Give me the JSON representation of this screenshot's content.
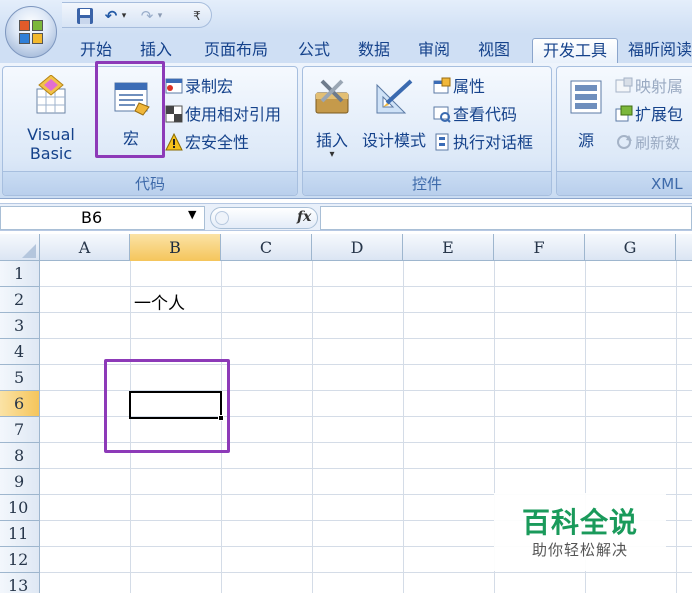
{
  "quick_access": {
    "save_icon": "save-icon",
    "undo_glyph": "↶",
    "redo_glyph": "↷",
    "dropdown_glyph": "▾",
    "customize_glyph": "₹"
  },
  "tabs": [
    {
      "label": "开始"
    },
    {
      "label": "插入"
    },
    {
      "label": "页面布局"
    },
    {
      "label": "公式"
    },
    {
      "label": "数据"
    },
    {
      "label": "审阅"
    },
    {
      "label": "视图"
    },
    {
      "label": "开发工具",
      "active": true
    },
    {
      "label": "福昕阅读"
    }
  ],
  "ribbon": {
    "code": {
      "label": "代码",
      "visual_basic": "Visual Basic",
      "macros": "宏",
      "record_macro": "录制宏",
      "relative_ref": "使用相对引用",
      "macro_security": "宏安全性"
    },
    "controls": {
      "label": "控件",
      "insert": "插入",
      "design_mode": "设计模式",
      "properties": "属性",
      "view_code": "查看代码",
      "run_dialog": "执行对话框"
    },
    "xml": {
      "label": "XML",
      "source": "源",
      "map_properties": "映射属",
      "expansion_packs": "扩展包",
      "refresh_data": "刷新数"
    }
  },
  "formula_bar": {
    "name_box": "B6",
    "fx": "fx",
    "formula": ""
  },
  "sheet": {
    "columns": [
      "A",
      "B",
      "C",
      "D",
      "E",
      "F",
      "G"
    ],
    "rows": [
      "1",
      "2",
      "3",
      "4",
      "5",
      "6",
      "7",
      "8",
      "9",
      "10",
      "11",
      "12",
      "13"
    ],
    "selected_column": "B",
    "selected_row": "6",
    "cells": {
      "B2": "一个人"
    }
  },
  "colors": {
    "highlight": "#8d3ab8",
    "selection_header": "#f5c55b"
  },
  "watermark": {
    "main": "百科全说",
    "sub": "助你轻松解决"
  }
}
